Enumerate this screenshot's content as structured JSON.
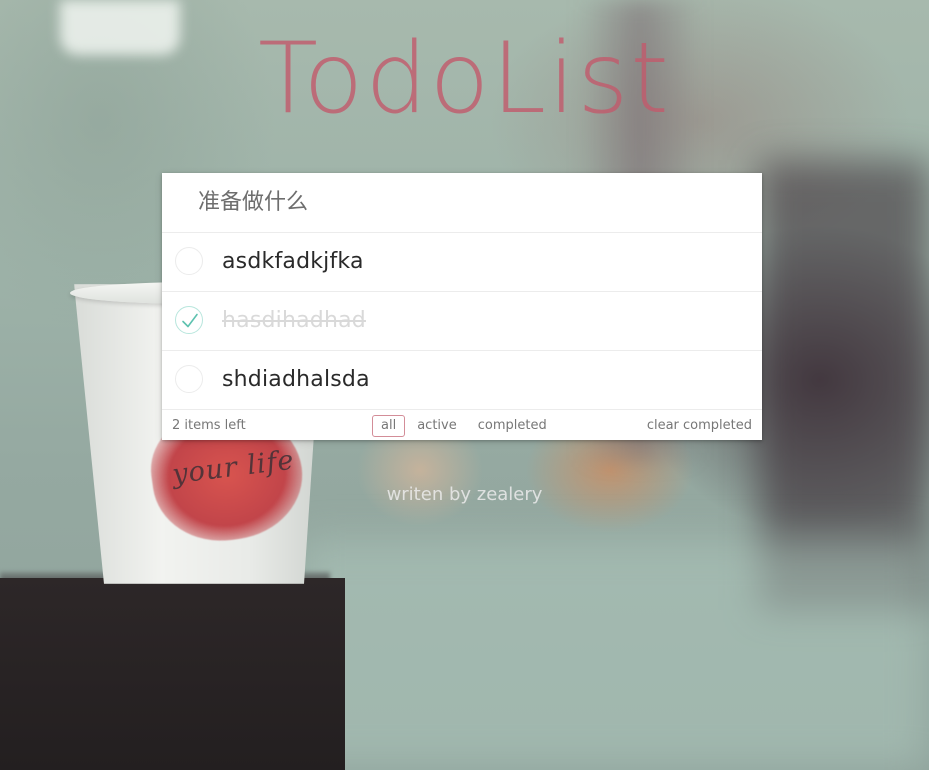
{
  "app": {
    "title": "TodoList",
    "credit": "writen by zealery"
  },
  "new_todo": {
    "placeholder": "准备做什么",
    "value": ""
  },
  "todos": [
    {
      "label": "asdkfadkjfka",
      "completed": false
    },
    {
      "label": "hasdihadhad",
      "completed": true
    },
    {
      "label": "shdiadhalsda",
      "completed": false
    }
  ],
  "footer": {
    "items_left": "2 items left",
    "filters": [
      {
        "label": "all",
        "selected": true
      },
      {
        "label": "active",
        "selected": false
      },
      {
        "label": "completed",
        "selected": false
      }
    ],
    "clear_completed": "clear completed"
  },
  "colors": {
    "accent": "#c15c6c",
    "check": "#5dc2af",
    "completed_text": "#d9d9d9"
  },
  "icons": {
    "checkmark": "check-icon",
    "empty_toggle": "circle-icon"
  }
}
